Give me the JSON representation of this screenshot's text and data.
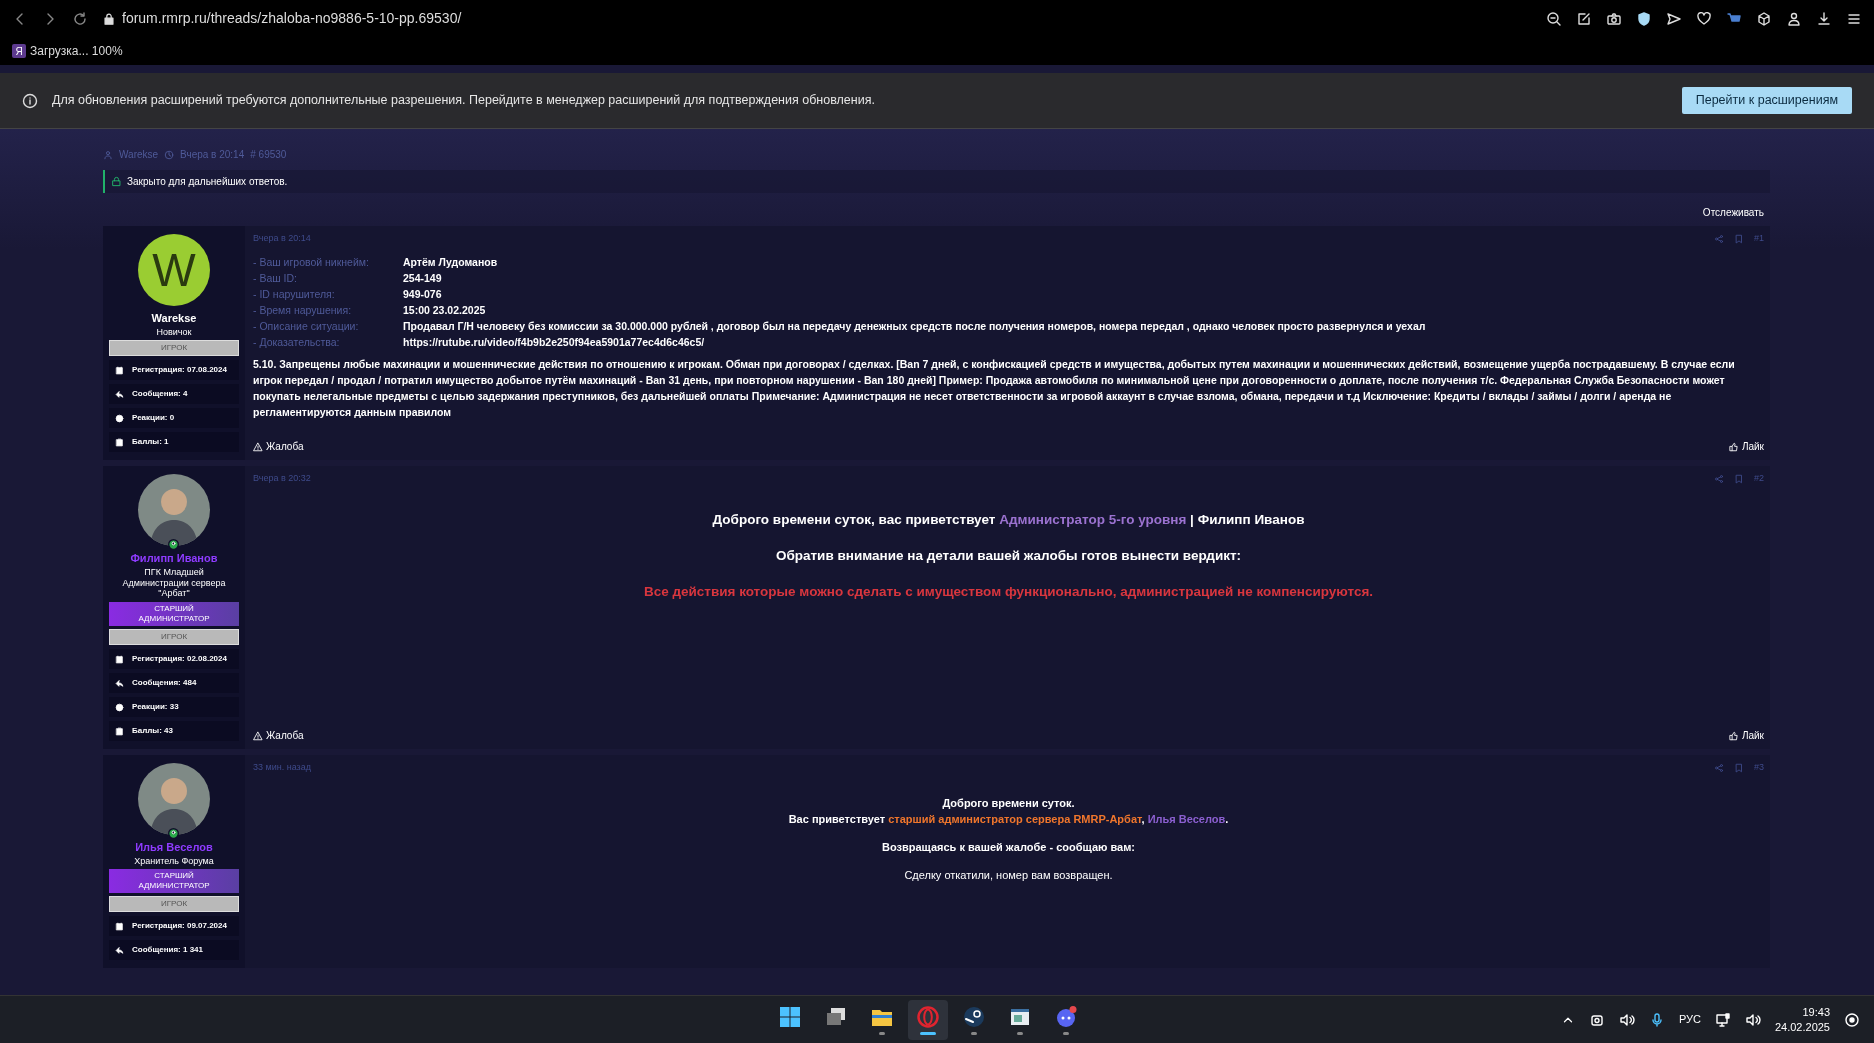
{
  "browser": {
    "url": "forum.rmrp.ru/threads/zhaloba-no9886-5-10-pp.69530/",
    "bookmark": {
      "icon_char": "Я",
      "label": "Загрузка... 100%"
    }
  },
  "notification": {
    "text": "Для обновления расширений требуются дополнительные разрешения. Перейдите в менеджер расширений для подтверждения обновления.",
    "button": "Перейти к расширениям"
  },
  "thread": {
    "author": "Warekse",
    "date": "Вчера в 20:14",
    "id": "# 69530",
    "locked_notice": "Закрыто для дальнейших ответов.",
    "watch": "Отслеживать"
  },
  "posts": [
    {
      "date": "Вчера в 20:14",
      "number": "#1",
      "user": {
        "name": "Warekse",
        "kind": "member",
        "avatar": {
          "kind": "letter",
          "letter": "W"
        },
        "online": false,
        "titles": [
          "Новичок"
        ],
        "banners": [
          {
            "label": "ИГРОК",
            "kind": "player"
          }
        ],
        "stats": [
          {
            "label": "Регистрация:",
            "value": "07.08.2024"
          },
          {
            "label": "Сообщения:",
            "value": "4"
          },
          {
            "label": "Реакции:",
            "value": "0"
          },
          {
            "label": "Баллы:",
            "value": "1"
          }
        ]
      },
      "blocks": [
        {
          "kind": "field",
          "label": "- Ваш игровой никнейм:",
          "value": "Артём Лудоманов"
        },
        {
          "kind": "field",
          "label": "- Ваш ID:",
          "value": "254-149"
        },
        {
          "kind": "field",
          "label": "- ID нарушителя:",
          "value": "949-076"
        },
        {
          "kind": "field",
          "label": "- Время нарушения:",
          "value": "15:00 23.02.2025"
        },
        {
          "kind": "field",
          "label": "- Описание ситуации:",
          "value": "Продавал Г/Н человеку без комиссии за 30.000.000 рублей , договор был на передачу денежных средств после получения номеров, номера передал , однако человек просто развернулся и уехал"
        },
        {
          "kind": "field",
          "label": "- Доказательства:",
          "value": "https://rutube.ru/video/f4b9b2e250f94ea5901a77ec4d6c46c5/"
        },
        {
          "kind": "paragraph",
          "text": "5.10. Запрещены любые махинации и мошеннические действия по отношению к игрокам. Обман при договорах / сделках. [Ban 7 дней, с конфискацией средств и имущества, добытых путем махинации и мошеннических действий, возмещение ущерба пострадавшему. В случае если игрок передал / продал / потратил имущество добытое путём махинаций - Ban 31 день, при повторном нарушении - Ban 180 дней] Пример: Продажа автомобиля по минимальной цене при договоренности о доплате, после получения т/с. Федеральная Служба Безопасности может покупать нелегальные предметы с целью задержания преступников, без дальнейшей оплаты Примечание: Администрация не несет ответственности за игровой аккаунт в случае взлома, обмана, передачи и т.д Исключение: Кредиты / вклады / займы / долги / аренда не регламентируются данным правилом"
        }
      ],
      "report": "Жалоба",
      "like": "Лайк"
    },
    {
      "date": "Вчера в 20:32",
      "number": "#2",
      "user": {
        "name": "Филипп Иванов",
        "kind": "staff",
        "avatar": {
          "kind": "picture"
        },
        "online": true,
        "titles": [
          "ПГК Младшей",
          "Администрации сервера",
          "\"Арбат\""
        ],
        "banners": [
          {
            "label": "СТАРШИЙ АДМИНИСТРАТОР",
            "kind": "staff"
          },
          {
            "label": "ИГРОК",
            "kind": "player"
          }
        ],
        "stats": [
          {
            "label": "Регистрация:",
            "value": "02.08.2024"
          },
          {
            "label": "Сообщения:",
            "value": "484"
          },
          {
            "label": "Реакции:",
            "value": "33"
          },
          {
            "label": "Баллы:",
            "value": "43"
          }
        ]
      },
      "blocks": [
        {
          "kind": "heading",
          "lines": [
            [
              {
                "text": "Доброго времени суток, вас приветствует "
              },
              {
                "text": "Администратор 5-го уровня",
                "color": "#9b72d0"
              },
              {
                "text": " | Филипп Иванов"
              }
            ]
          ]
        },
        {
          "kind": "heading",
          "lines": [
            [
              {
                "text": "Обратив внимание на детали вашей жалобы готов вынести вердикт:"
              }
            ]
          ]
        },
        {
          "kind": "alert",
          "lines": [
            [
              {
                "text": "Все действия которые можно сделать с имуществом функционально, администрацией не компенсируются."
              }
            ]
          ]
        }
      ],
      "report": "Жалоба",
      "like": "Лайк"
    },
    {
      "date": "33 мин. назад",
      "number": "#3",
      "user": {
        "name": "Илья Веселов",
        "kind": "staff",
        "avatar": {
          "kind": "picture"
        },
        "online": true,
        "titles": [
          "Хранитель Форума"
        ],
        "banners": [
          {
            "label": "СТАРШИЙ АДМИНИСТРАТОР",
            "kind": "staff"
          },
          {
            "label": "ИГРОК",
            "kind": "player"
          }
        ],
        "stats": [
          {
            "label": "Регистрация:",
            "value": "09.07.2024"
          },
          {
            "label": "Сообщения:",
            "value": "1 341"
          }
        ]
      },
      "blocks": [
        {
          "kind": "strong",
          "lines": [
            [
              {
                "text": "Доброго времени суток."
              }
            ],
            [
              {
                "text": "Вас приветствует "
              },
              {
                "text": "старший администратор сервера RMRP-Арбат",
                "color": "#f0762c"
              },
              {
                "text": ", "
              },
              {
                "text": "Илья Веселов",
                "color": "#8b5fd0"
              },
              {
                "text": "."
              }
            ]
          ]
        },
        {
          "kind": "strong",
          "lines": [
            [
              {
                "text": "Возвращаясь к вашей жалобе - сообщаю вам:"
              }
            ]
          ]
        },
        {
          "kind": "normal",
          "lines": [
            [
              {
                "text": "Сделку откатили, номер вам возвращен."
              }
            ]
          ]
        }
      ]
    }
  ],
  "taskbar": {
    "apps": [
      {
        "kind": "start",
        "selected": false,
        "running": false
      },
      {
        "kind": "taskview",
        "selected": false,
        "running": false
      },
      {
        "kind": "folder",
        "selected": false,
        "running": true
      },
      {
        "kind": "browser",
        "selected": true,
        "running": true
      },
      {
        "kind": "steam",
        "selected": false,
        "running": true
      },
      {
        "kind": "window",
        "selected": false,
        "running": true
      },
      {
        "kind": "chat",
        "selected": false,
        "running": true
      }
    ],
    "language": "РУС",
    "time": "19:43",
    "date": "24.02.2025"
  }
}
